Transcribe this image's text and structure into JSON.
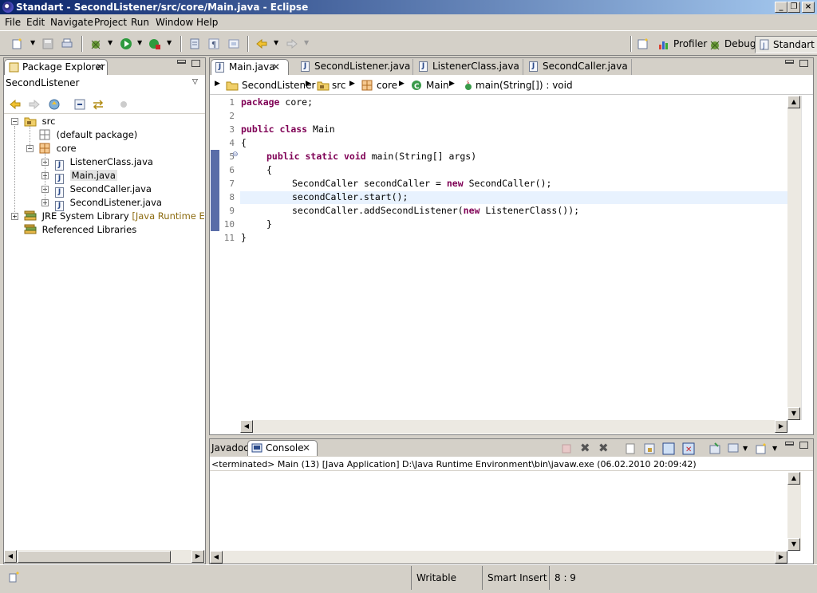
{
  "window": {
    "title": "Standart - SecondListener/src/core/Main.java - Eclipse"
  },
  "menu": [
    "File",
    "Edit",
    "Navigate",
    "Project",
    "Run",
    "Window",
    "Help"
  ],
  "perspectives": {
    "profiler": "Profiler",
    "debug": "Debug",
    "standart": "Standart"
  },
  "package_explorer": {
    "tab_label": "Package Explorer",
    "project": "SecondListener",
    "tree": {
      "src": "src",
      "default_package": "(default package)",
      "core": "core",
      "files": [
        "ListenerClass.java",
        "Main.java",
        "SecondCaller.java",
        "SecondListener.java"
      ],
      "jre_label": "JRE System Library",
      "jre_detail": "[Java Runtime Environment]",
      "referenced_libraries": "Referenced Libraries"
    }
  },
  "editor": {
    "tabs": [
      "Main.java",
      "SecondListener.java",
      "ListenerClass.java",
      "SecondCaller.java"
    ],
    "breadcrumb": [
      "SecondListener",
      "src",
      "core",
      "Main",
      "main(String[]) : void"
    ],
    "line_numbers": [
      "1",
      "2",
      "3",
      "4",
      "5",
      "6",
      "7",
      "8",
      "9",
      "10",
      "11"
    ],
    "code": {
      "l1_kw": "package",
      "l1_rest": " core;",
      "l3_kw1": "public",
      "l3_kw2": "class",
      "l3_rest": " Main",
      "l4": "{",
      "l5_kw1": "public",
      "l5_kw2": "static",
      "l5_kw3": "void",
      "l5_rest": " main(String[] args)",
      "l6": "{",
      "l7_a": "SecondCaller secondCaller = ",
      "l7_kw": "new",
      "l7_b": " SecondCaller();",
      "l8": "secondCaller.start();",
      "l9_a": "secondCaller.addSecondListener(",
      "l9_kw": "new",
      "l9_b": " ListenerClass());",
      "l10": "}",
      "l11": "}"
    }
  },
  "bottom": {
    "tabs": {
      "javadoc": "Javadoc",
      "console": "Console"
    },
    "console_header": "<terminated> Main (13) [Java Application] D:\\Java Runtime Environment\\bin\\javaw.exe (06.02.2010 20:09:42)"
  },
  "status": {
    "writable": "Writable",
    "insert_mode": "Smart Insert",
    "position": "8 : 9"
  },
  "colors": {
    "keyword": "#7f0055",
    "title_start": "#0a246a",
    "title_end": "#a6caf0",
    "current_line": "#e8f2fe"
  }
}
